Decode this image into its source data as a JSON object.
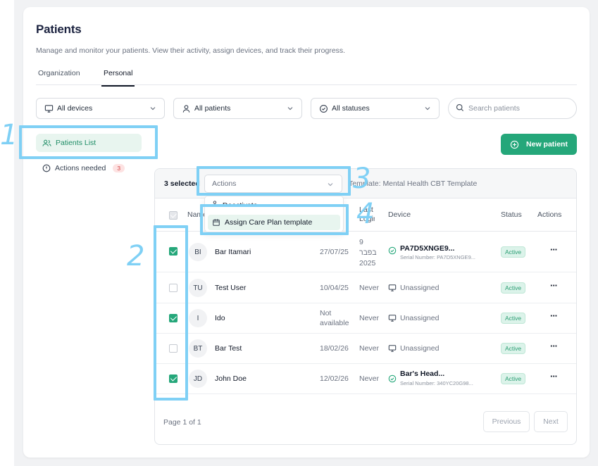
{
  "page": {
    "title": "Patients",
    "subtitle": "Manage and monitor your patients. View their activity, assign devices, and track their progress."
  },
  "tabs": [
    {
      "label": "Organization"
    },
    {
      "label": "Personal"
    }
  ],
  "filters": {
    "devices": "All devices",
    "patients": "All patients",
    "statuses": "All statuses",
    "search_placeholder": "Search patients"
  },
  "sidebar": {
    "items": [
      {
        "label": "Patients List",
        "icon": "users-icon"
      },
      {
        "label": "Actions needed",
        "icon": "info-icon",
        "badge": "3"
      }
    ]
  },
  "new_patient_button": "New patient",
  "table": {
    "selected_count": "3 selected",
    "actions_select": "Actions",
    "template_text": "Template: Mental Health CBT Template",
    "headers": {
      "name": "Name",
      "last_login": "Last Login",
      "device": "Device",
      "status": "Status",
      "actions": "Actions"
    },
    "rows": [
      {
        "checked": true,
        "initials": "BI",
        "name": "Bar Itamari",
        "date": "27/07/25",
        "last_login": "9 בפבר 2025",
        "device": "PA7D5XNGE9...",
        "serial": "Serial Number: PA7D5XNGE9...",
        "device_assigned": true,
        "status": "Active"
      },
      {
        "checked": false,
        "initials": "TU",
        "name": "Test User",
        "date": "10/04/25",
        "last_login": "Never",
        "device": "Unassigned",
        "serial": "",
        "device_assigned": false,
        "status": "Active"
      },
      {
        "checked": true,
        "initials": "I",
        "name": "Ido",
        "date": "Not available",
        "last_login": "Never",
        "device": "Unassigned",
        "serial": "",
        "device_assigned": false,
        "status": "Active"
      },
      {
        "checked": false,
        "initials": "BT",
        "name": "Bar Test",
        "date": "18/02/26",
        "last_login": "Never",
        "device": "Unassigned",
        "serial": "",
        "device_assigned": false,
        "status": "Active"
      },
      {
        "checked": true,
        "initials": "JD",
        "name": "John Doe",
        "date": "12/02/26",
        "last_login": "Never",
        "device": "Bar's Head...",
        "serial": "Serial Number: 340YC20G98...",
        "device_assigned": true,
        "status": "Active"
      }
    ],
    "pagination": {
      "page_text": "Page 1 of 1",
      "previous": "Previous",
      "next": "Next"
    }
  },
  "dropdown": {
    "item1": "Deactivate",
    "item2": "Assign Care Plan template"
  },
  "annotations": {
    "n1": "1",
    "n2": "2",
    "n3": "3",
    "n4": "4"
  },
  "colors": {
    "accent": "#25a77a",
    "highlight": "#7fd0f5",
    "badge_red": "#d24646"
  }
}
